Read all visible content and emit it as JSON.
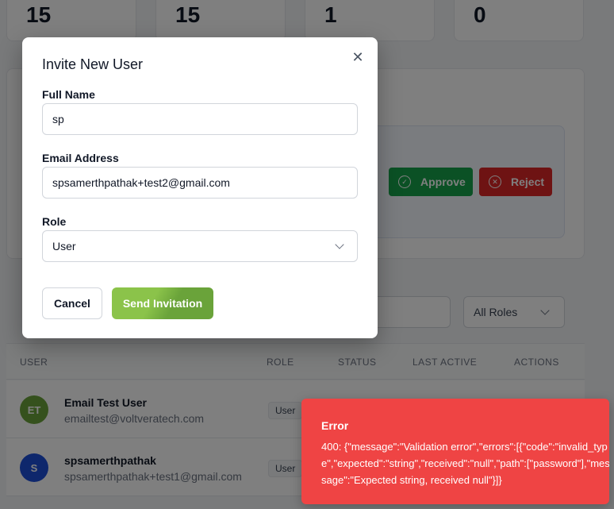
{
  "stats": [
    "15",
    "15",
    "1",
    "0"
  ],
  "request_card": {
    "approve_label": "Approve",
    "reject_label": "Reject"
  },
  "filters": {
    "role_value": "All Roles"
  },
  "table": {
    "headers": [
      "USER",
      "ROLE",
      "STATUS",
      "LAST ACTIVE",
      "ACTIONS"
    ],
    "rows": [
      {
        "initials": "ET",
        "name": "Email Test User",
        "email": "emailtest@voltveratech.com",
        "role": "User",
        "avatar_color": "#6aa33a"
      },
      {
        "initials": "S",
        "name": "spsamerthpathak",
        "email": "spsamerthpathak+test1@gmail.com",
        "role": "User",
        "avatar_color": "#1d4ed8"
      }
    ]
  },
  "modal": {
    "title": "Invite New User",
    "full_name_label": "Full Name",
    "full_name_value": "sp",
    "email_label": "Email Address",
    "email_value": "spsamerthpathak+test2@gmail.com",
    "role_label": "Role",
    "role_value": "User",
    "cancel_label": "Cancel",
    "send_label": "Send Invitation"
  },
  "toast": {
    "title": "Error",
    "message": "400: {\"message\":\"Validation error\",\"errors\":[{\"code\":\"invalid_type\",\"expected\":\"string\",\"received\":\"null\",\"path\":[\"password\"],\"message\":\"Expected string, received null\"}]}"
  },
  "colors": {
    "brand_green": "#8bc34a",
    "approve": "#16a34a",
    "reject": "#dc2626",
    "error": "#ef4444"
  }
}
